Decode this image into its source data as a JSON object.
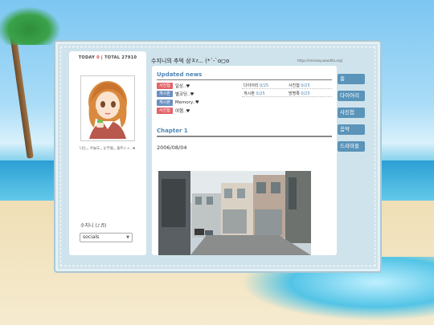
{
  "counter": {
    "today_label": "TODAY",
    "today_value": "0",
    "total_label": "TOTAL",
    "total_value": "27910"
  },
  "profile": {
    "caption": "나는,, 우늘도,, 눈부울,, 울트ㄷㅅ..★"
  },
  "bgm": {
    "label": "수지니 (♪♬)",
    "selected": "socials"
  },
  "topbar": {
    "title": "수지니의 추억 상ㅈr... (*´-`o◻o",
    "url": "https://misskey.woodita.org/"
  },
  "updated_news": {
    "heading": "Updated news",
    "items": [
      {
        "badge": "사진첩",
        "badge_color": "#e06468",
        "text": "일상..♥"
      },
      {
        "badge": "게시판",
        "badge_color": "#6b8fbf",
        "text": "별코딩..♥"
      },
      {
        "badge": "게시판",
        "badge_color": "#6b8fbf",
        "text": "Memory..♥"
      },
      {
        "badge": "사진첩",
        "badge_color": "#e06468",
        "text": "여행..♥"
      }
    ],
    "stats": [
      {
        "label": "다이어리",
        "value": "0/25"
      },
      {
        "label": "사진첩",
        "value": "0/25"
      },
      {
        "label": "게시판",
        "value": "0/25"
      },
      {
        "label": "방명록",
        "value": "0/25"
      }
    ]
  },
  "chapter": {
    "heading": "Chapter 1",
    "date": "2006/08/04"
  },
  "nav": [
    "홈",
    "다이어리",
    "사진첩",
    "음악",
    "드라마들"
  ],
  "colors": {
    "accent": "#4f86b4",
    "nav": "#5a94b9",
    "badge_red": "#e06468",
    "badge_blue": "#6b8fbf"
  }
}
